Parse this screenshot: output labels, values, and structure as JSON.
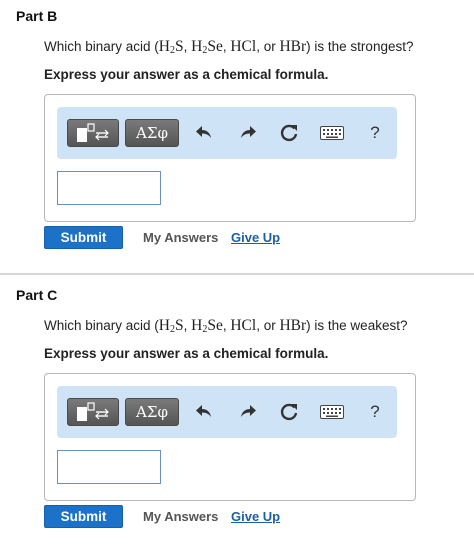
{
  "parts": [
    {
      "title": "Part B",
      "question": {
        "prefix": "Which binary acid (",
        "h2s": {
          "h": "H",
          "sub": "2",
          "rest": "S"
        },
        "sep1": ", ",
        "h2se": {
          "h": "H",
          "sub": "2",
          "rest": "Se"
        },
        "sep2": ", ",
        "hcl": "HCl",
        "sep3": ", or ",
        "hbr": "HBr",
        "suffix": ") is the strongest?"
      },
      "instruction": "Express your answer as a chemical formula.",
      "input_value": "",
      "submit_label": "Submit",
      "my_answers_label": "My Answers",
      "give_up_label": "Give Up"
    },
    {
      "title": "Part C",
      "question": {
        "prefix": "Which binary acid (",
        "h2s": {
          "h": "H",
          "sub": "2",
          "rest": "S"
        },
        "sep1": ", ",
        "h2se": {
          "h": "H",
          "sub": "2",
          "rest": "Se"
        },
        "sep2": ", ",
        "hcl": "HCl",
        "sep3": ", or ",
        "hbr": "HBr",
        "suffix": ") is the weakest?"
      },
      "instruction": "Express your answer as a chemical formula.",
      "input_value": "",
      "submit_label": "Submit",
      "my_answers_label": "My Answers",
      "give_up_label": "Give Up"
    }
  ],
  "toolbar": {
    "template_icon": "template-icon",
    "symbols_label": "ΑΣφ",
    "undo_icon": "undo-icon",
    "redo_icon": "redo-icon",
    "reset_icon": "reset-icon",
    "keyboard_icon": "keyboard-icon",
    "help_label": "?"
  },
  "colors": {
    "submit": "#1b72c8",
    "toolbar_bg": "#cfe3f6",
    "link": "#1b5fa8"
  }
}
